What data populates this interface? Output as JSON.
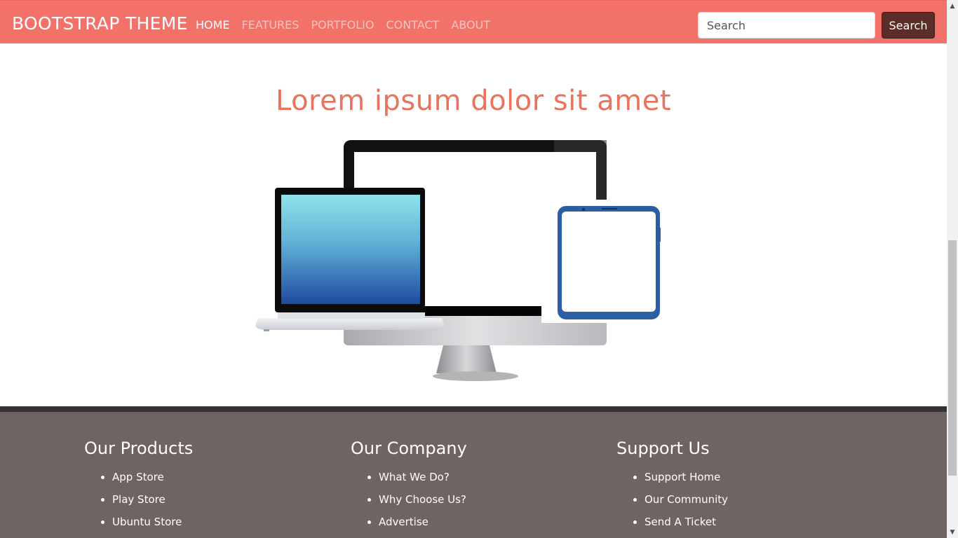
{
  "navbar": {
    "brand": "BOOTSTRAP THEME",
    "items": [
      {
        "label": "HOME",
        "active": true
      },
      {
        "label": "FEATURES",
        "active": false
      },
      {
        "label": "PORTFOLIO",
        "active": false
      },
      {
        "label": "CONTACT",
        "active": false
      },
      {
        "label": "ABOUT",
        "active": false
      }
    ],
    "search": {
      "placeholder": "Search",
      "value": ""
    },
    "search_button": "Search"
  },
  "hero": {
    "title": "Lorem ipsum dolor sit amet",
    "image_icon": "devices-illustration"
  },
  "footer": {
    "columns": [
      {
        "heading": "Our Products",
        "links": [
          "App Store",
          "Play Store",
          "Ubuntu Store"
        ]
      },
      {
        "heading": "Our Company",
        "links": [
          "What We Do?",
          "Why Choose Us?",
          "Advertise"
        ]
      },
      {
        "heading": "Support Us",
        "links": [
          "Support Home",
          "Our Community",
          "Send A Ticket"
        ]
      }
    ]
  },
  "colors": {
    "navbar": "#f2726a",
    "title": "#e8745d",
    "search_button": "#5a2d29",
    "footer": "#6e6462",
    "footer_border": "#333333"
  }
}
